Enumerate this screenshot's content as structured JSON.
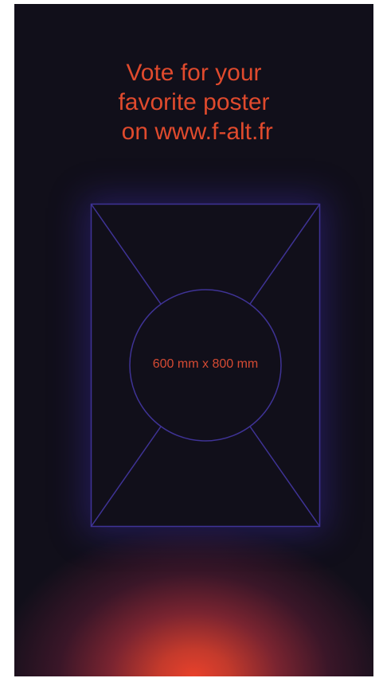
{
  "headline": {
    "line1": "Vote for your",
    "line2": "favorite poster",
    "line3": " on www.f-alt.fr"
  },
  "placeholder": {
    "dimension_label": "600 mm x 800 mm"
  },
  "colors": {
    "background": "#110f1a",
    "text_accent": "#e04a2d",
    "frame_stroke": "#3f3396",
    "glow": "#e8412b"
  }
}
